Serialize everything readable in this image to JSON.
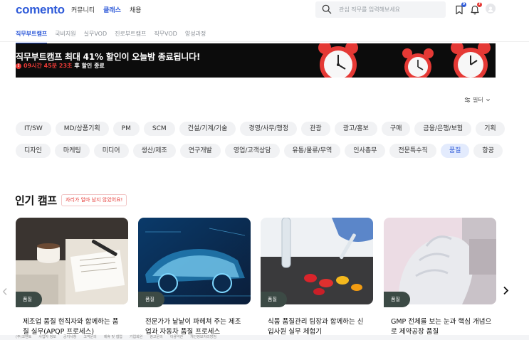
{
  "header": {
    "logo": "comento",
    "nav": [
      "커뮤니티",
      "클래스",
      "채용"
    ],
    "nav_active": 1,
    "search_placeholder": "관심 직무를 입력해보세요",
    "bookmark_badge": "9",
    "notification_badge": "7"
  },
  "subnav": {
    "items": [
      "직무부트캠프",
      "국비지원",
      "실무VOD",
      "진로부트캠프",
      "직무VOD",
      "양성과정"
    ],
    "active": 0
  },
  "banner": {
    "title": "직무부트캠프 최대 41% 할인이 오늘밤 종료됩니다!",
    "timer_icon": "!",
    "timer": "09시간 45분 23초",
    "timer_suffix": "후 할인 종료"
  },
  "filter": {
    "label": "필터"
  },
  "chips": {
    "row1": [
      "IT/SW",
      "MD/상품기획",
      "PM",
      "SCM",
      "건설/기계/기술",
      "경영/사무/행정",
      "관광",
      "광고/홍보",
      "구매",
      "금융/은행/보험",
      "기획"
    ],
    "row2": [
      "디자인",
      "마케팅",
      "미디어",
      "생산/제조",
      "연구개발",
      "영업/고객상담",
      "유통/물류/무역",
      "인사총무",
      "전문특수직",
      "품질",
      "항공"
    ],
    "active": "품질"
  },
  "section": {
    "title": "인기 캠프",
    "tag": "자리가 얼마 남지 않았어요!"
  },
  "cards": [
    {
      "category": "품질",
      "title": "제조업 품질 현직자와 함께하는 품질 실무(APQP 프로세스)"
    },
    {
      "category": "품질",
      "title": "전문가가 낱낱이 파헤쳐 주는 제조업과 자동차 품질 프로세스"
    },
    {
      "category": "품질",
      "title": "식품 품질관리 팀장과 함께하는 신입사원 실무 체험기"
    },
    {
      "category": "품질",
      "title": "GMP 전체를 보는 눈과 핵심 개념으로 제약공장 품질"
    }
  ],
  "footer": {
    "items": [
      "(주)코멘토",
      "사업자 정보",
      "공지사항",
      "고객문의",
      "제휴 및 협업",
      "기업회원",
      "광고문의",
      "이용약관",
      "개인정보처리방침"
    ]
  },
  "colors": {
    "accent": "#2f5bd9",
    "alert": "#e53935",
    "banner_bg": "#0c0c0c",
    "category_bg": "#3c4a45"
  }
}
